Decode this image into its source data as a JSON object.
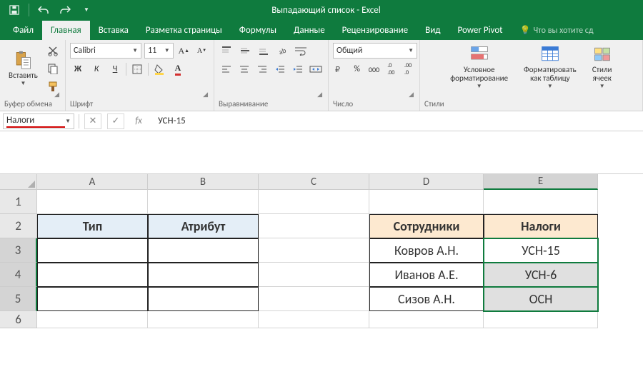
{
  "titlebar": {
    "title": "Выпадающий список - Excel"
  },
  "tabs": {
    "file": "Файл",
    "home": "Главная",
    "insert": "Вставка",
    "layout": "Разметка страницы",
    "formulas": "Формулы",
    "data": "Данные",
    "review": "Рецензирование",
    "view": "Вид",
    "pivot": "Power Pivot",
    "tell": "Что вы хотите сд"
  },
  "ribbon": {
    "clipboard": {
      "paste": "Вставить",
      "label": "Буфер обмена"
    },
    "font": {
      "name": "Calibri",
      "size": "11",
      "bold": "Ж",
      "italic": "К",
      "underline": "Ч",
      "label": "Шрифт"
    },
    "align": {
      "label": "Выравнивание"
    },
    "number": {
      "format": "Общий",
      "label": "Число"
    },
    "styles": {
      "cond": "Условное\nформатирование",
      "table": "Форматировать\nкак таблицу",
      "cell": "Стили\nячеек",
      "label": "Стили"
    }
  },
  "formula_bar": {
    "name_box": "Налоги",
    "value": "УСН-15",
    "fx": "fx"
  },
  "columns": [
    "A",
    "B",
    "C",
    "D",
    "E"
  ],
  "rows": [
    "1",
    "2",
    "3",
    "4",
    "5",
    "6"
  ],
  "cells": {
    "A2": "Тип",
    "B2": "Атрибут",
    "D2": "Сотрудники",
    "E2": "Налоги",
    "D3": "Ковров А.Н.",
    "E3": "УСН-15",
    "D4": "Иванов А.Е.",
    "E4": "УСН-6",
    "D5": "Сизов А.Н.",
    "E5": "ОСН"
  },
  "chart_data": {
    "type": "table",
    "tables": [
      {
        "name": "left",
        "headers": [
          "Тип",
          "Атрибут"
        ],
        "rows": [
          [
            "",
            ""
          ],
          [
            "",
            ""
          ],
          [
            "",
            ""
          ]
        ]
      },
      {
        "name": "right",
        "headers": [
          "Сотрудники",
          "Налоги"
        ],
        "rows": [
          [
            "Ковров А.Н.",
            "УСН-15"
          ],
          [
            "Иванов А.Е.",
            "УСН-6"
          ],
          [
            "Сизов А.Н.",
            "ОСН"
          ]
        ]
      }
    ],
    "selected_range": "E3:E5"
  }
}
